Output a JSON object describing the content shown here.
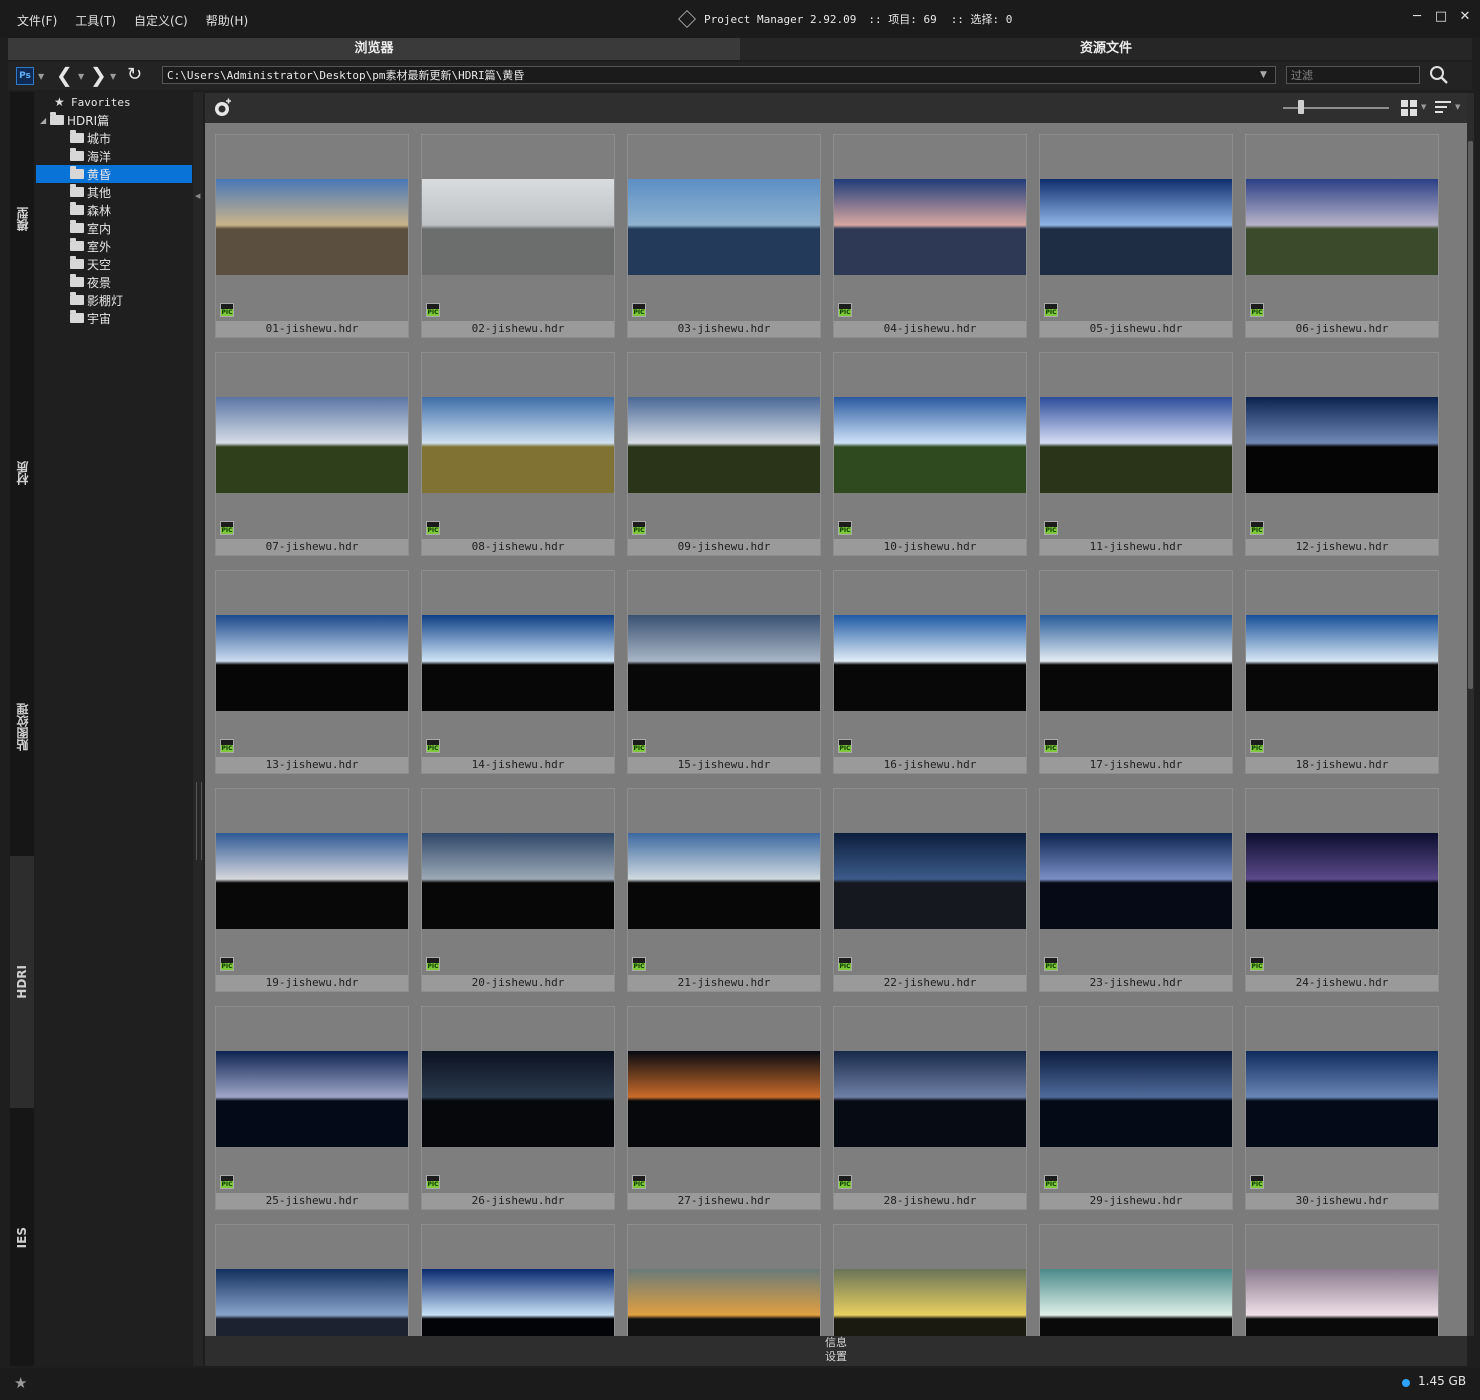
{
  "menu": [
    "文件(F)",
    "工具(T)",
    "自定义(C)",
    "帮助(H)"
  ],
  "app": {
    "name": "Project Manager 2.92.09",
    "items_label": ":: 项目: 69",
    "sel_label": ":: 选择: 0"
  },
  "window_controls": [
    "minimize-icon",
    "maximize-icon",
    "close-icon"
  ],
  "tabs": [
    {
      "label": "浏览器",
      "active": true
    },
    {
      "label": "资源文件",
      "active": false
    }
  ],
  "address": {
    "path": "C:\\Users\\Administrator\\Desktop\\pm素材最新更新\\HDRI篇\\黄昏",
    "filter_placeholder": "过滤"
  },
  "side_tabs": [
    "模型",
    "材质",
    "贴图纹理",
    "HDRI",
    "IES"
  ],
  "active_side_tab": "HDRI",
  "tree": {
    "favorites": "Favorites",
    "root": "HDRI篇",
    "folders": [
      "城市",
      "海洋",
      "黄昏",
      "其他",
      "森林",
      "室内",
      "室外",
      "天空",
      "夜景",
      "影棚灯",
      "宇宙"
    ],
    "selected": "黄昏"
  },
  "colors": {
    "accent": "#0a73d8",
    "disk_dot": "#2ea3ff",
    "pic_badge": "#7ec83a"
  },
  "files": [
    "01-jishewu.hdr",
    "02-jishewu.hdr",
    "03-jishewu.hdr",
    "04-jishewu.hdr",
    "05-jishewu.hdr",
    "06-jishewu.hdr",
    "07-jishewu.hdr",
    "08-jishewu.hdr",
    "09-jishewu.hdr",
    "10-jishewu.hdr",
    "11-jishewu.hdr",
    "12-jishewu.hdr",
    "13-jishewu.hdr",
    "14-jishewu.hdr",
    "15-jishewu.hdr",
    "16-jishewu.hdr",
    "17-jishewu.hdr",
    "18-jishewu.hdr",
    "19-jishewu.hdr",
    "20-jishewu.hdr",
    "21-jishewu.hdr",
    "22-jishewu.hdr",
    "23-jishewu.hdr",
    "24-jishewu.hdr",
    "25-jishewu.hdr",
    "26-jishewu.hdr",
    "27-jishewu.hdr",
    "28-jishewu.hdr",
    "29-jishewu.hdr",
    "30-jishewu.hdr",
    "",
    "",
    "",
    "",
    "",
    ""
  ],
  "info_panel": {
    "info": "信息",
    "settings": "设置"
  },
  "status": {
    "disk": "1.45 GB"
  }
}
